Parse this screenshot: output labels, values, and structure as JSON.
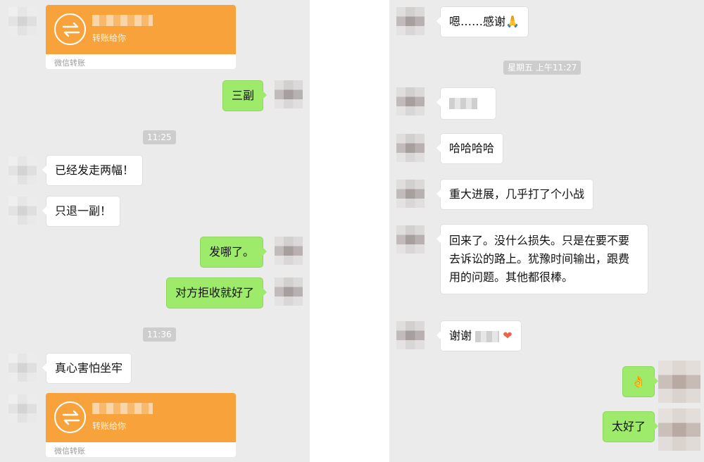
{
  "left": {
    "transfer_1": {
      "subtitle": "转账给你",
      "footer": "微信转账"
    },
    "msg_sanfu": "三副",
    "time_1": "11:25",
    "msg_yijing": "已经发走两幅！",
    "msg_zhitui": "只退一副！",
    "msg_fanale": "发哪了。",
    "msg_duifang": "对方拒收就好了",
    "time_2": "11:36",
    "msg_zhenxin": "真心害怕坐牢",
    "transfer_2": {
      "subtitle": "转账给你",
      "footer": "微信转账"
    }
  },
  "right": {
    "msg_en": "嗯……感谢🙏",
    "time_1": "星期五 上午11:27",
    "msg_haha": "哈哈哈哈",
    "msg_zhongda": "重大进展，几乎打了个小战",
    "msg_huilai": "回来了。没什么损失。只是在要不要去诉讼的路上。犹豫时间输出，跟费用的问题。其他都很棒。",
    "msg_xiexie": "谢谢",
    "msg_xiexie_emoji": "❤",
    "msg_ok": "👌",
    "msg_taihao": "太好了"
  },
  "colors": {
    "chat_bg": "#ebebeb",
    "incoming_bubble": "#ffffff",
    "outgoing_bubble": "#9eea6a",
    "transfer_orange": "#f7a23b",
    "timestamp_bg": "#cdcdcd"
  }
}
